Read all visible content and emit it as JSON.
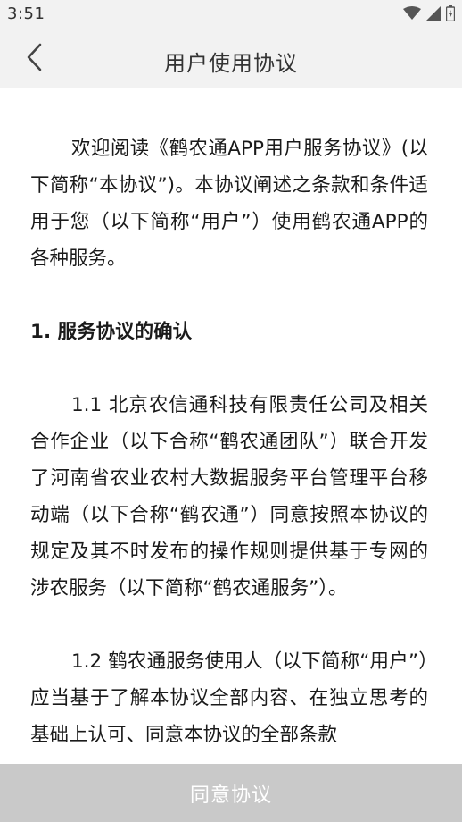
{
  "status_bar": {
    "time": "3:51"
  },
  "nav": {
    "title": "用户使用协议",
    "back_icon": "chevron-left-icon"
  },
  "content": {
    "intro": "欢迎阅读《鹤农通APP用户服务协议》(以下简称“本协议”)。本协议阐述之条款和条件适用于您（以下简称“用户”）使用鹤农通APP的各种服务。",
    "section1_heading": "1. 服务协议的确认",
    "clause_1_1": "1.1 北京农信通科技有限责任公司及相关合作企业（以下合称“鹤农通团队”）联合开发了河南省农业农村大数据服务平台管理平台移动端（以下合称“鹤农通”）同意按照本协议的规定及其不时发布的操作规则提供基于专网的涉农服务（以下简称“鹤农通服务”）。",
    "clause_1_2": "1.2 鹤农通服务使用人（以下简称“用户”）应当基于了解本协议全部内容、在独立思考的基础上认可、同意本协议的全部条款"
  },
  "footer": {
    "agree_label": "同意协议"
  },
  "colors": {
    "status_bg": "#f2f2f2",
    "nav_bg": "#f2f2f2",
    "agree_bg": "#c9c9c9",
    "agree_text": "#ffffff",
    "body_text": "#1a1a1a"
  }
}
